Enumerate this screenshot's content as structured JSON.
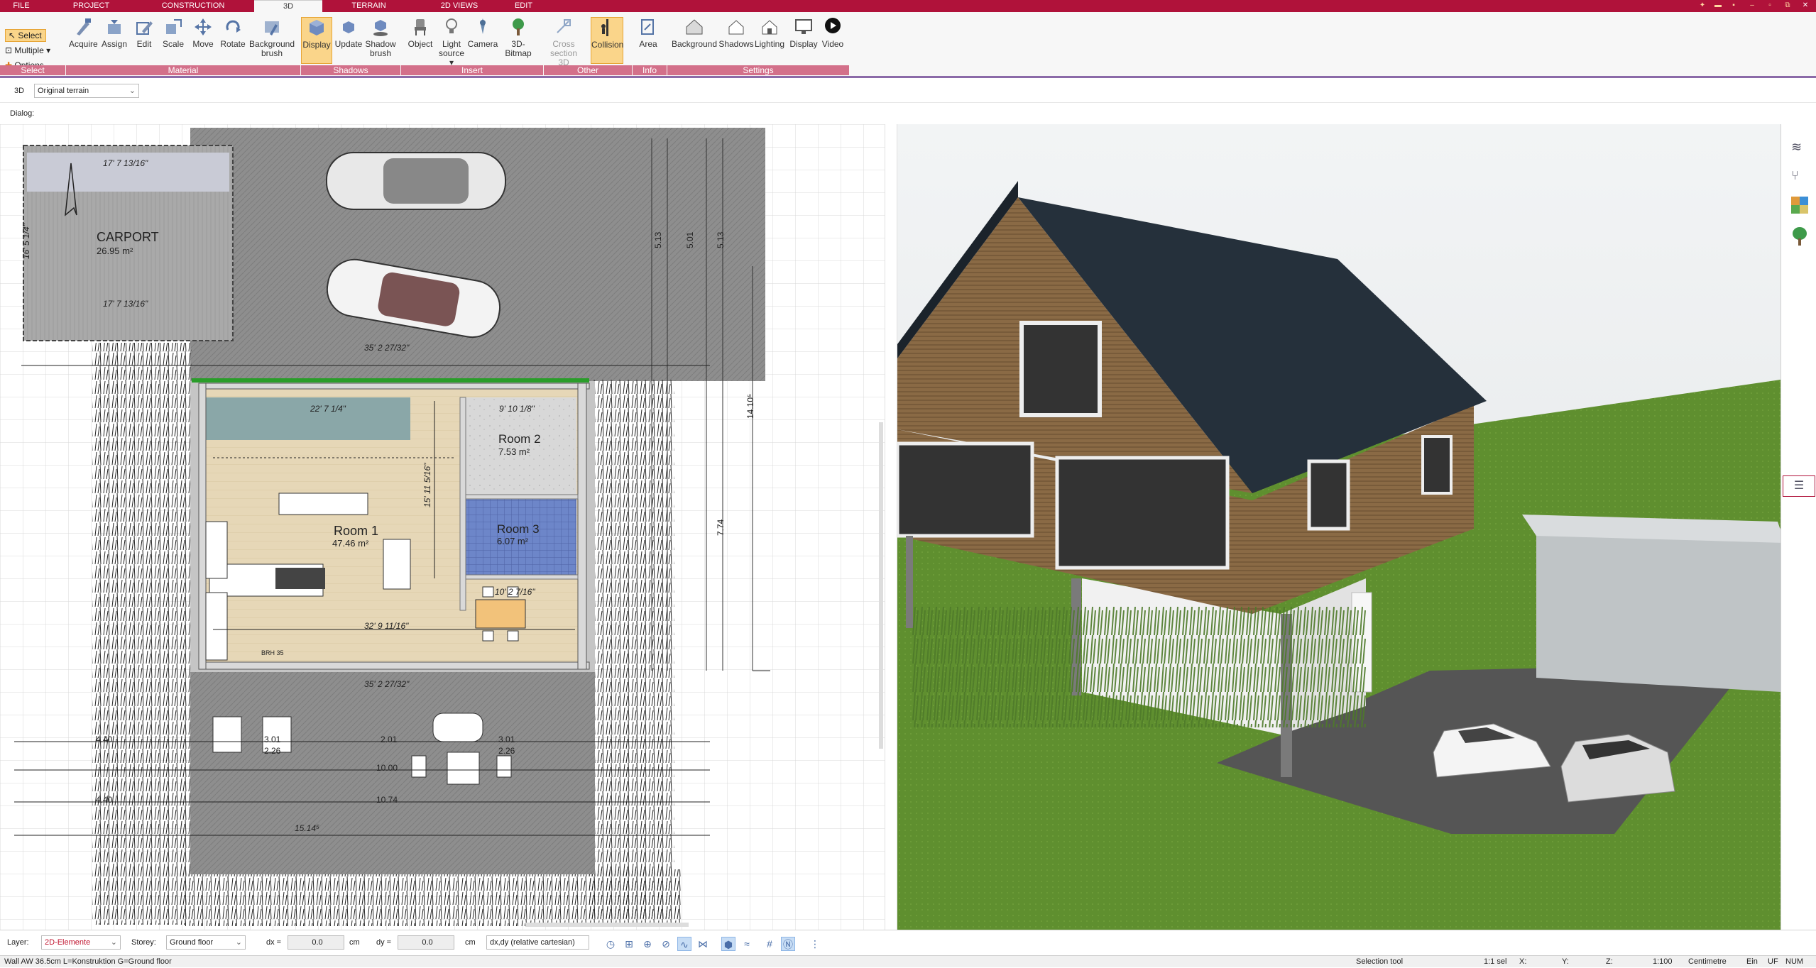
{
  "menu_tabs": [
    "FILE",
    "PROJECT",
    "CONSTRUCTION",
    "3D",
    "TERRAIN",
    "2D VIEWS",
    "EDIT"
  ],
  "select_group": {
    "select": "Select",
    "multiple": "Multiple",
    "options": "Options",
    "label": "Select"
  },
  "ribbon_buttons": {
    "acquire": "Acquire",
    "assign": "Assign",
    "edit": "Edit",
    "scale": "Scale",
    "move": "Move",
    "rotate": "Rotate",
    "background_brush": "Background brush",
    "display": "Display",
    "update": "Update",
    "shadow_brush": "Shadow brush",
    "object": "Object",
    "light_source": "Light source",
    "camera": "Camera",
    "bitmap": "3D-Bitmap",
    "cross_section": "Cross section 3D",
    "collision": "Collision",
    "area": "Area",
    "background": "Background",
    "shadows": "Shadows",
    "lighting": "Lighting",
    "display2": "Display",
    "video": "Video"
  },
  "groups": {
    "select": "Select",
    "material": "Material",
    "shadows": "Shadows",
    "insert": "Insert",
    "other": "Other",
    "info": "Info",
    "settings": "Settings"
  },
  "view_row": {
    "mode": "3D",
    "terrain": "Original terrain"
  },
  "dialog_label": "Dialog:",
  "plan": {
    "carport_title": "CARPORT",
    "carport_area": "26.95 m²",
    "carport_dim_top": "17' 7 13/16\"",
    "carport_dim_bottom": "17' 7 13/16\"",
    "carport_dim_side": "16' 5 1/4\"",
    "room1": "Room 1",
    "room1_area": "47.46 m²",
    "room2": "Room 2",
    "room2_area": "7.53 m²",
    "room3": "Room 3",
    "room3_area": "6.07 m²",
    "dim_35a": "35' 2 27/32\"",
    "dim_35b": "35' 2 27/32\"",
    "dim_22": "22' 7 1/4\"",
    "dim_15": "15' 11 5/16\"",
    "dim_32": "32' 9 11/16\"",
    "dim_10": "10' 2 7/16\"",
    "dim_9": "9' 10 1/8\"",
    "dim_1510": "15.14⁵",
    "dim_1074": "10.74",
    "dim_1000": "10.00",
    "dim_774": "7.74",
    "dim_1410": "14.10⁵",
    "dim_513a": "5.13",
    "dim_501": "5.01",
    "dim_513b": "5.13",
    "dim_301a": "3.01",
    "dim_301b": "3.01",
    "dim_201": "2.01",
    "dim_226a": "2.26",
    "dim_226b": "2.26",
    "dim_440a": "4.40",
    "dim_440b": "4.40",
    "brh": "BRH 35"
  },
  "status": {
    "layer_label": "Layer:",
    "layer_value": "2D-Elemente",
    "storey_label": "Storey:",
    "storey_value": "Ground floor",
    "dx_label": "dx =",
    "dx_value": "0.0",
    "dx_unit": "cm",
    "dy_label": "dy =",
    "dy_value": "0.0",
    "dy_unit": "cm",
    "coord_mode": "dx,dy (relative cartesian)"
  },
  "status2": {
    "wall_info": "Wall AW 36.5cm L=Konstruktion G=Ground floor",
    "tool": "Selection tool",
    "sel": "1:1 sel",
    "x": "X:",
    "y": "Y:",
    "z": "Z:",
    "scale": "1:100",
    "unit": "Centimetre",
    "ein": "Ein",
    "uf": "UF",
    "num": "NUM"
  },
  "colors": {
    "brand": "#b0123a",
    "group": "#d3708a",
    "accent_sel": "#fad58a"
  }
}
